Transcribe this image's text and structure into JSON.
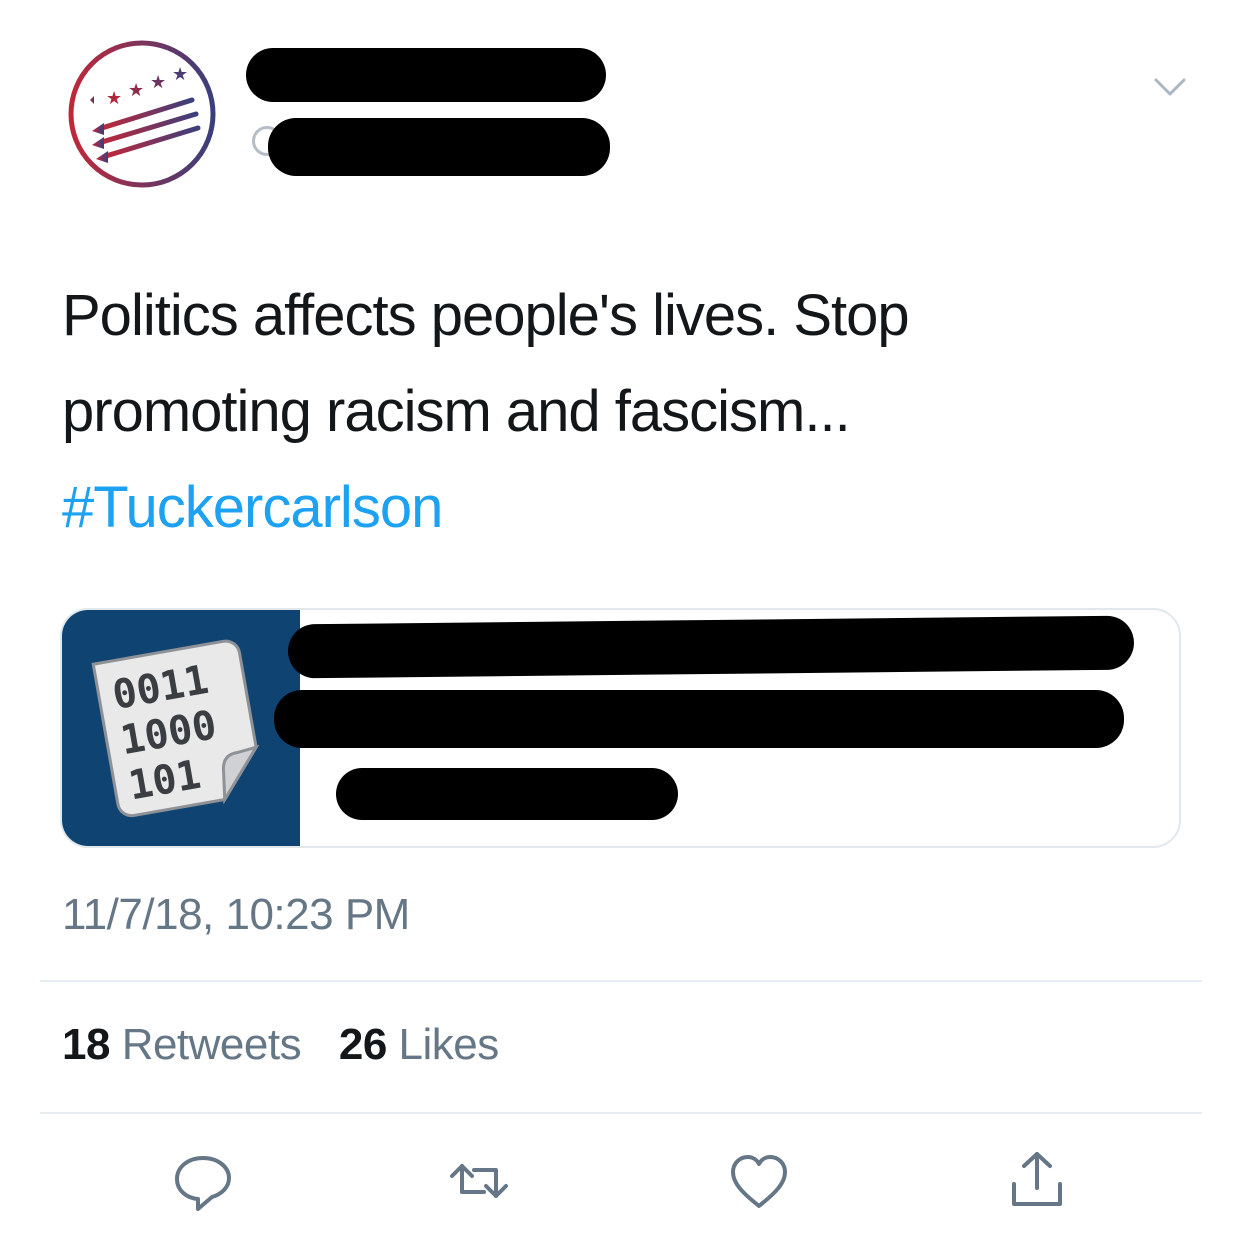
{
  "tweet": {
    "text": "Politics affects people's lives. Stop promoting racism and fascism...",
    "hashtag": "#Tuckercarlson",
    "timestamp": "11/7/18, 10:23 PM"
  },
  "card": {
    "thumbnail_lines": [
      "0011",
      "1000",
      "101"
    ]
  },
  "stats": {
    "retweets_count": "18",
    "retweets_label": "Retweets",
    "likes_count": "26",
    "likes_label": "Likes"
  },
  "actions": {
    "reply": "reply-icon",
    "retweet": "retweet-icon",
    "like": "heart-icon",
    "share": "share-icon"
  },
  "colors": {
    "hashtag": "#1da1f2",
    "secondary_text": "#657786",
    "card_thumb_bg": "#0f4371",
    "logo_red": "#b0283a",
    "logo_navy": "#3c3f78"
  }
}
